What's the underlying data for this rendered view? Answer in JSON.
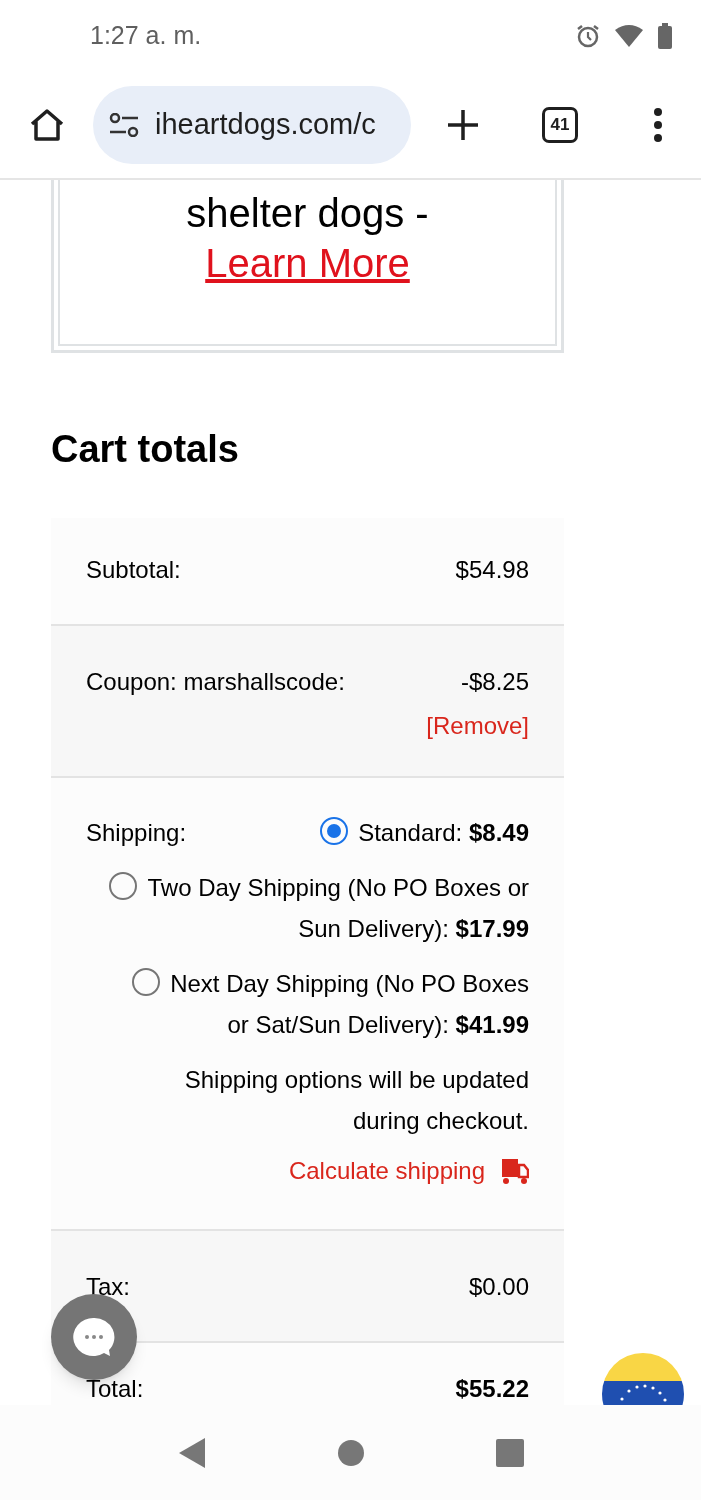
{
  "status_bar": {
    "time": "1:27 a. m."
  },
  "browser": {
    "url": "iheartdogs.com/c",
    "tab_count": "41"
  },
  "promo": {
    "text": "shelter dogs -",
    "link": "Learn More"
  },
  "cart_totals": {
    "title": "Cart totals",
    "subtotal": {
      "label": "Subtotal:",
      "value": "$54.98"
    },
    "coupon": {
      "label": "Coupon: marshallscode:",
      "value": "-$8.25",
      "remove": "[Remove]"
    },
    "shipping": {
      "label": "Shipping:",
      "options": [
        {
          "text": "Standard: ",
          "price": "$8.49",
          "selected": true
        },
        {
          "text": "Two Day Shipping (No PO Boxes or Sun Delivery): ",
          "price": "$17.99",
          "selected": false
        },
        {
          "text": "Next Day Shipping (No PO Boxes or Sat/Sun Delivery): ",
          "price": "$41.99",
          "selected": false
        }
      ],
      "note": "Shipping options will be updated during checkout.",
      "calculate": "Calculate shipping"
    },
    "tax": {
      "label": "Tax:",
      "value": "$0.00"
    },
    "total": {
      "label": "Total:",
      "value": "$55.22"
    }
  }
}
